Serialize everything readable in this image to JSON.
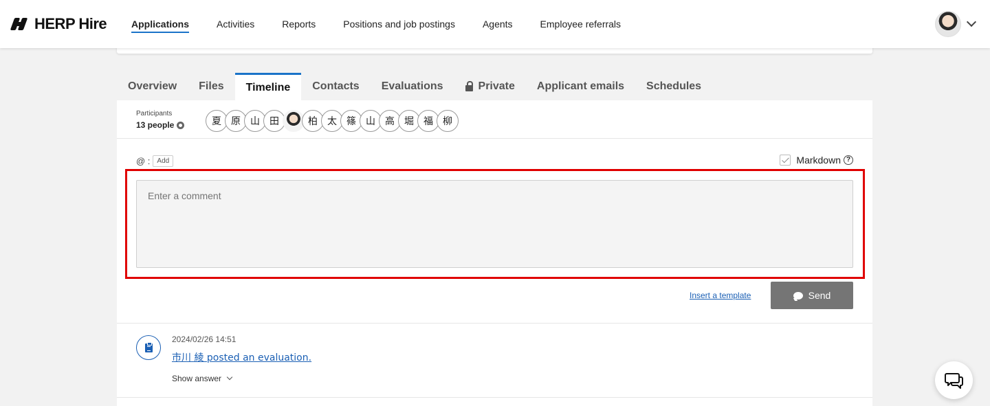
{
  "header": {
    "logo_text": "HERP Hire",
    "nav": [
      {
        "label": "Applications",
        "active": true
      },
      {
        "label": "Activities"
      },
      {
        "label": "Reports"
      },
      {
        "label": "Positions and job postings"
      },
      {
        "label": "Agents"
      },
      {
        "label": "Employee referrals"
      }
    ]
  },
  "tabs": [
    {
      "label": "Overview"
    },
    {
      "label": "Files"
    },
    {
      "label": "Timeline",
      "active": true
    },
    {
      "label": "Contacts"
    },
    {
      "label": "Evaluations"
    },
    {
      "label": "Private",
      "icon": "lock-icon"
    },
    {
      "label": "Applicant emails"
    },
    {
      "label": "Schedules"
    }
  ],
  "participants": {
    "label": "Participants",
    "count": "13 people",
    "chips": [
      "夏",
      "原",
      "山",
      "田",
      "",
      "柏",
      "太",
      "篠",
      "山",
      "高",
      "堀",
      "福",
      "柳"
    ]
  },
  "composer": {
    "mention_prefix": "@ :",
    "add_label": "Add",
    "markdown_label": "Markdown",
    "help_glyph": "?",
    "placeholder": "Enter a comment",
    "template_link": "Insert a template",
    "send_label": "Send"
  },
  "timeline": [
    {
      "time": "2024/02/26 14:51",
      "title": "市川 綾 posted an evaluation.",
      "show_answer": "Show answer",
      "icon": "clipboard-icon"
    }
  ],
  "colors": {
    "accent": "#1a73c8",
    "link": "#1a5fb4",
    "highlight": "#e00000",
    "send_button": "#757575"
  }
}
